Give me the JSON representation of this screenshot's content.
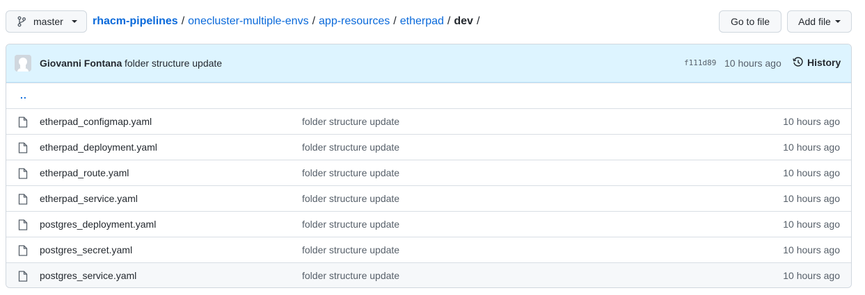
{
  "branch": {
    "name": "master",
    "icon": "git-branch-icon"
  },
  "breadcrumb": {
    "repo": "rhacm-pipelines",
    "path": [
      "onecluster-multiple-envs",
      "app-resources",
      "etherpad"
    ],
    "current": "dev",
    "separator": "/"
  },
  "actions": {
    "goto_file": "Go to file",
    "add_file": "Add file"
  },
  "latest_commit": {
    "author": "Giovanni Fontana",
    "message": "folder structure update",
    "sha": "f111d89",
    "age": "10 hours ago",
    "history_label": "History"
  },
  "parent_dir": "..",
  "files": [
    {
      "name": "etherpad_configmap.yaml",
      "message": "folder structure update",
      "age": "10 hours ago"
    },
    {
      "name": "etherpad_deployment.yaml",
      "message": "folder structure update",
      "age": "10 hours ago"
    },
    {
      "name": "etherpad_route.yaml",
      "message": "folder structure update",
      "age": "10 hours ago"
    },
    {
      "name": "etherpad_service.yaml",
      "message": "folder structure update",
      "age": "10 hours ago"
    },
    {
      "name": "postgres_deployment.yaml",
      "message": "folder structure update",
      "age": "10 hours ago"
    },
    {
      "name": "postgres_secret.yaml",
      "message": "folder structure update",
      "age": "10 hours ago"
    },
    {
      "name": "postgres_service.yaml",
      "message": "folder structure update",
      "age": "10 hours ago"
    }
  ],
  "colors": {
    "link": "#0969da",
    "header_bg": "#ddf4ff",
    "muted": "#57606a",
    "border": "#d0d7de"
  }
}
